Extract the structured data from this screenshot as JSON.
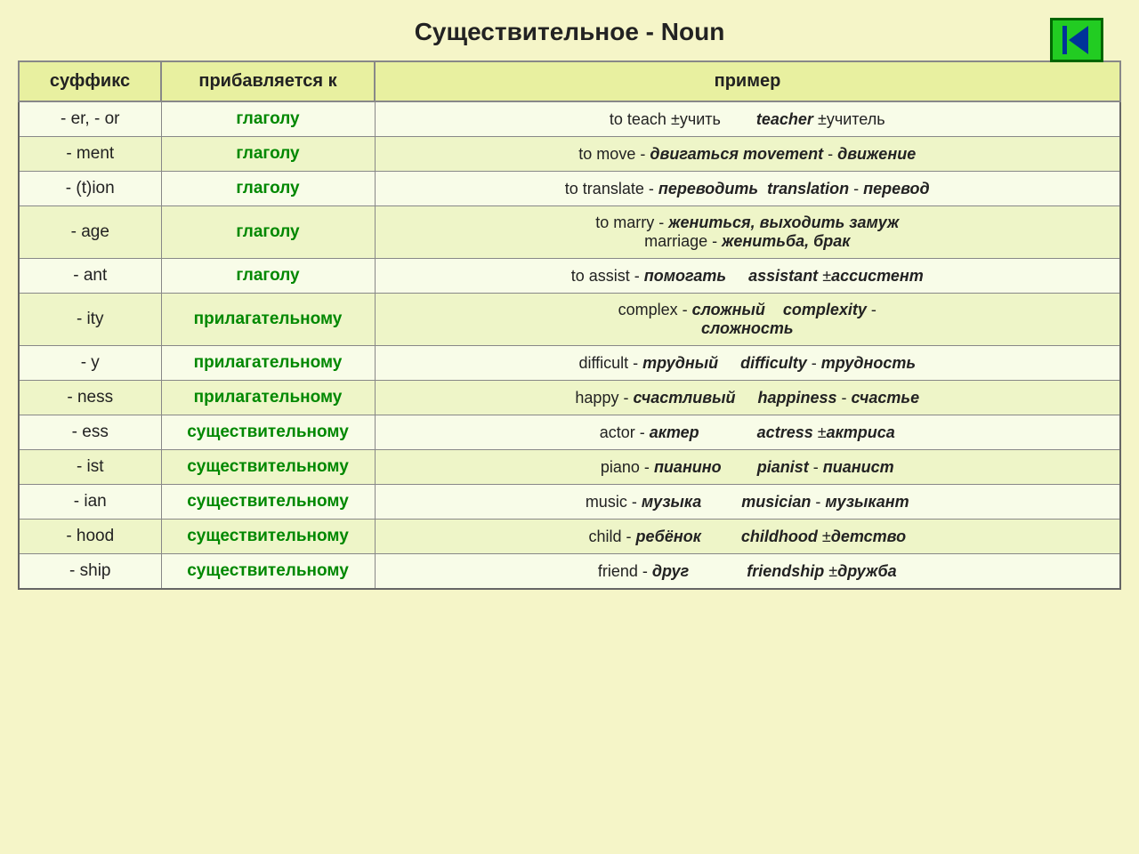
{
  "title": "Существительное - Noun",
  "nav_btn_label": "◀|",
  "table": {
    "headers": [
      "суффикс",
      "прибавляется к",
      "пример"
    ],
    "rows": [
      {
        "suffix": "- er, - or",
        "added_to": "глаголу",
        "example_html": "to teach ±учить &nbsp;&nbsp;&nbsp;&nbsp;&nbsp;&nbsp; <i><b>teacher</b></i> ±учитель"
      },
      {
        "suffix": "- ment",
        "added_to": "глаголу",
        "example_html": "to move - <i><b>двигаться</b></i> <i><b>movement</b></i> - <i><b>движение</b></i>"
      },
      {
        "suffix": "- (t)ion",
        "added_to": "глаголу",
        "example_html": "to translate - <i><b>переводить</b></i> &nbsp;<i><b>translation</b></i> - <i><b>перевод</b></i>"
      },
      {
        "suffix": "- age",
        "added_to": "глаголу",
        "example_html": "to marry - <i><b>жениться, выходить замуж</b></i><br>marriage - <i><b>женитьба, брак</b></i>"
      },
      {
        "suffix": "- ant",
        "added_to": "глаголу",
        "example_html": "to assist - <i><b>помогать</b></i> &nbsp;&nbsp;&nbsp; <i><b>assistant</b></i> ±<i><b>ассистент</b></i>"
      },
      {
        "suffix": "- ity",
        "added_to": "прилагательному",
        "example_html": "complex - <i><b>сложный</b></i> &nbsp;&nbsp; <i><b>complexity</b></i> -<br><i><b>сложность</b></i>"
      },
      {
        "suffix": "- y",
        "added_to": "прилагательному",
        "example_html": "difficult - <i><b>трудный</b></i> &nbsp;&nbsp;&nbsp; <i><b>difficulty</b></i> - <i><b>трудность</b></i>"
      },
      {
        "suffix": "- ness",
        "added_to": "прилагательному",
        "example_html": "happy - <i><b>счастливый</b></i> &nbsp;&nbsp;&nbsp; <i><b>happiness</b></i> - <i><b>счастье</b></i>"
      },
      {
        "suffix": "- ess",
        "added_to": "существительному",
        "example_html": "actor - <i><b>актер</b></i> &nbsp;&nbsp;&nbsp;&nbsp;&nbsp;&nbsp;&nbsp;&nbsp;&nbsp;&nbsp;&nbsp; <i><b>actress</b></i> ±<i><b>актриса</b></i>"
      },
      {
        "suffix": "- ist",
        "added_to": "существительному",
        "example_html": "piano - <i><b>пианино</b></i> &nbsp;&nbsp;&nbsp;&nbsp;&nbsp;&nbsp; <i><b>pianist</b></i> - <i><b>пианист</b></i>"
      },
      {
        "suffix": "- ian",
        "added_to": "существительному",
        "example_html": "music - <i><b>музыка</b></i> &nbsp;&nbsp;&nbsp;&nbsp;&nbsp;&nbsp;&nbsp; <i><b>musician</b></i> - <i><b>музыкант</b></i>"
      },
      {
        "suffix": "- hood",
        "added_to": "существительному",
        "example_html": "child - <i><b>ребёнок</b></i> &nbsp;&nbsp;&nbsp;&nbsp;&nbsp;&nbsp;&nbsp; <i><b>childhood</b></i> ±<i><b>детство</b></i>"
      },
      {
        "suffix": "- ship",
        "added_to": "существительному",
        "example_html": "friend - <i><b>друг</b></i> &nbsp;&nbsp;&nbsp;&nbsp;&nbsp;&nbsp;&nbsp;&nbsp;&nbsp;&nbsp;&nbsp; <i><b>friendship</b></i> ±<i><b>дружба</b></i>"
      }
    ]
  }
}
